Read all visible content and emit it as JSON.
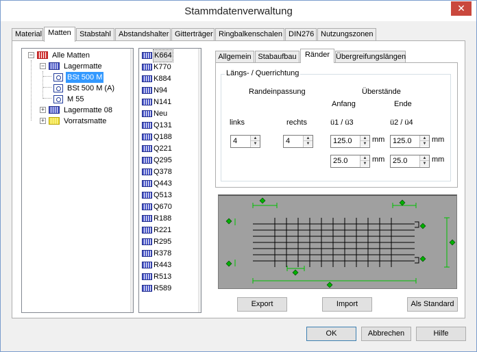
{
  "window": {
    "title": "Stammdatenverwaltung",
    "close_glyph": "✕"
  },
  "tabs": [
    {
      "label": "Material"
    },
    {
      "label": "Matten"
    },
    {
      "label": "Stabstahl"
    },
    {
      "label": "Abstandshalter"
    },
    {
      "label": "Gitterträger"
    },
    {
      "label": "Ringbalkenschalen"
    },
    {
      "label": "DIN276"
    },
    {
      "label": "Nutzungszonen"
    }
  ],
  "tree": {
    "root": {
      "label": "Alle Matten",
      "icon": "mat-red-icon"
    },
    "lagermatte": {
      "label": "Lagermatte",
      "icon": "mat-blue-icon"
    },
    "children": [
      {
        "label": "BSt 500 M"
      },
      {
        "label": "BSt 500 M (A)"
      },
      {
        "label": "M 55"
      }
    ],
    "lagermatte08": {
      "label": "Lagermatte 08"
    },
    "vorratsmatte": {
      "label": "Vorratsmatte",
      "icon": "mat-yellow-icon"
    }
  },
  "mat_list": {
    "items": [
      "K664",
      "K770",
      "K884",
      "N94",
      "N141",
      "Neu",
      "Q131",
      "Q188",
      "Q221",
      "Q295",
      "Q378",
      "Q443",
      "Q513",
      "Q670",
      "R188",
      "R221",
      "R295",
      "R378",
      "R443",
      "R513",
      "R589"
    ],
    "selected": "K664"
  },
  "inner_tabs": [
    {
      "label": "Allgemein"
    },
    {
      "label": "Stabaufbau"
    },
    {
      "label": "Ränder"
    },
    {
      "label": "Übergreifungslängen"
    }
  ],
  "raender": {
    "group_title": "Längs- / Querrichtung",
    "randeinpassung": "Randeinpassung",
    "ueberstaende": "Überstände",
    "anfang": "Anfang",
    "ende": "Ende",
    "links": "links",
    "rechts": "rechts",
    "u1u3": "ü1 / ü3",
    "u2u4": "ü2 / ü4",
    "links_value": "4",
    "rechts_value": "4",
    "u1": "125.0",
    "u2": "125.0",
    "u3": "25.0",
    "u4": "25.0",
    "unit": "mm"
  },
  "buttons": {
    "export": "Export",
    "import": "Import",
    "standard": "Als Standard",
    "ok": "OK",
    "cancel": "Abbrechen",
    "help": "Hilfe"
  },
  "colors": {
    "accent": "#3399ff",
    "preview_bg": "#a0a0a0",
    "dim_line": "#00c000"
  }
}
